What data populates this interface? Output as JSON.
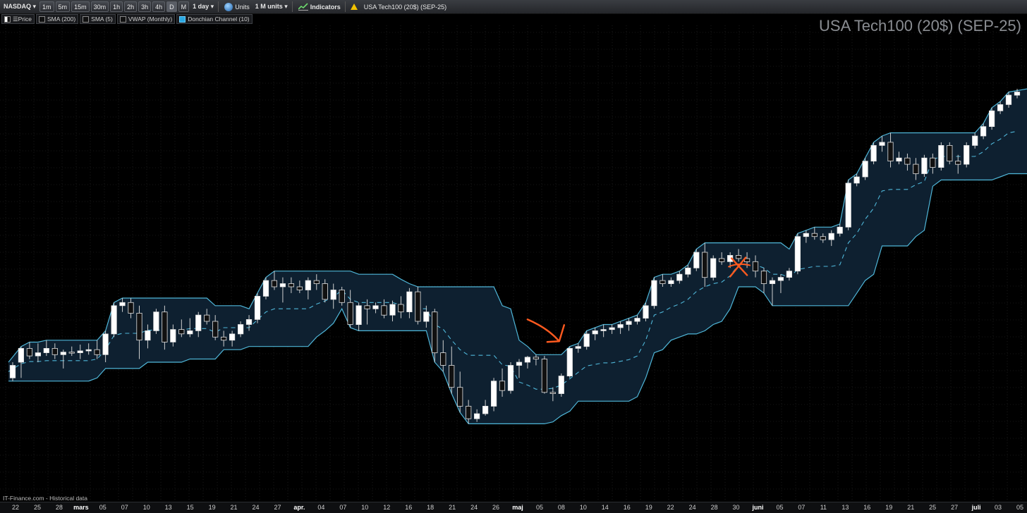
{
  "toolbar": {
    "symbol": "NASDAQ",
    "intervals": [
      "1m",
      "5m",
      "15m",
      "30m",
      "1h",
      "2h",
      "3h",
      "4h",
      "D",
      "M"
    ],
    "active_interval": "D",
    "period": "1 day",
    "units_label": "Units",
    "units_value": "1 M units",
    "indicators_label": "Indicators",
    "instrument": "USA Tech100 (20$) (SEP-25)"
  },
  "legend": {
    "items": [
      {
        "label": "Price",
        "checked": true
      },
      {
        "label": "SMA (200)",
        "checked": false
      },
      {
        "label": "SMA (5)",
        "checked": false
      },
      {
        "label": "VWAP (Monthly)",
        "checked": false
      },
      {
        "label": "Donchian Channel (10)",
        "checked": true
      }
    ]
  },
  "title": "USA Tech100 (20$) (SEP-25)",
  "watermark": "IT-Finance.com - Historical data",
  "colors": {
    "channel_line": "#4fb6d8",
    "channel_fill": "#0f2233",
    "up_candle": "#ffffff",
    "down_candle": "#111111",
    "annotation": "#ff5a1f"
  },
  "x_axis_labels": [
    {
      "label": "22",
      "month": false
    },
    {
      "label": "25",
      "month": false
    },
    {
      "label": "28",
      "month": false
    },
    {
      "label": "mars",
      "month": true
    },
    {
      "label": "05",
      "month": false
    },
    {
      "label": "07",
      "month": false
    },
    {
      "label": "10",
      "month": false
    },
    {
      "label": "13",
      "month": false
    },
    {
      "label": "15",
      "month": false
    },
    {
      "label": "19",
      "month": false
    },
    {
      "label": "21",
      "month": false
    },
    {
      "label": "24",
      "month": false
    },
    {
      "label": "27",
      "month": false
    },
    {
      "label": "apr.",
      "month": true
    },
    {
      "label": "04",
      "month": false
    },
    {
      "label": "07",
      "month": false
    },
    {
      "label": "10",
      "month": false
    },
    {
      "label": "12",
      "month": false
    },
    {
      "label": "16",
      "month": false
    },
    {
      "label": "18",
      "month": false
    },
    {
      "label": "21",
      "month": false
    },
    {
      "label": "24",
      "month": false
    },
    {
      "label": "26",
      "month": false
    },
    {
      "label": "maj",
      "month": true
    },
    {
      "label": "05",
      "month": false
    },
    {
      "label": "08",
      "month": false
    },
    {
      "label": "10",
      "month": false
    },
    {
      "label": "14",
      "month": false
    },
    {
      "label": "16",
      "month": false
    },
    {
      "label": "19",
      "month": false
    },
    {
      "label": "22",
      "month": false
    },
    {
      "label": "24",
      "month": false
    },
    {
      "label": "28",
      "month": false
    },
    {
      "label": "30",
      "month": false
    },
    {
      "label": "juni",
      "month": true
    },
    {
      "label": "05",
      "month": false
    },
    {
      "label": "07",
      "month": false
    },
    {
      "label": "11",
      "month": false
    },
    {
      "label": "13",
      "month": false
    },
    {
      "label": "16",
      "month": false
    },
    {
      "label": "19",
      "month": false
    },
    {
      "label": "21",
      "month": false
    },
    {
      "label": "25",
      "month": false
    },
    {
      "label": "27",
      "month": false
    },
    {
      "label": "juli",
      "month": true
    },
    {
      "label": "03",
      "month": false
    },
    {
      "label": "05",
      "month": false
    }
  ],
  "chart_data": {
    "type": "candlestick",
    "candles": [
      [
        0.35,
        0.6,
        0.3,
        0.55
      ],
      [
        0.6,
        0.85,
        0.35,
        0.82
      ],
      [
        0.82,
        0.92,
        0.65,
        0.7
      ],
      [
        0.7,
        0.9,
        0.6,
        0.75
      ],
      [
        0.75,
        0.95,
        0.7,
        0.82
      ],
      [
        0.82,
        0.9,
        0.65,
        0.72
      ],
      [
        0.72,
        0.8,
        0.5,
        0.76
      ],
      [
        0.76,
        0.85,
        0.7,
        0.75
      ],
      [
        0.75,
        0.88,
        0.65,
        0.78
      ],
      [
        0.78,
        0.9,
        0.72,
        0.8
      ],
      [
        0.8,
        0.95,
        0.65,
        0.72
      ],
      [
        0.72,
        1.1,
        0.6,
        1.05
      ],
      [
        1.05,
        1.55,
        1.0,
        1.5
      ],
      [
        1.5,
        1.62,
        1.4,
        1.55
      ],
      [
        1.55,
        1.62,
        1.3,
        1.38
      ],
      [
        1.38,
        1.5,
        0.65,
        0.95
      ],
      [
        0.95,
        1.2,
        0.82,
        1.1
      ],
      [
        1.1,
        1.45,
        1.05,
        1.4
      ],
      [
        1.4,
        1.5,
        0.8,
        0.92
      ],
      [
        0.92,
        1.2,
        0.85,
        1.12
      ],
      [
        1.12,
        1.28,
        1.0,
        1.05
      ],
      [
        1.05,
        1.3,
        1.0,
        1.1
      ],
      [
        1.1,
        1.4,
        1.0,
        1.35
      ],
      [
        1.35,
        1.45,
        1.2,
        1.25
      ],
      [
        1.25,
        1.35,
        0.95,
        1.0
      ],
      [
        1.0,
        1.1,
        0.85,
        0.95
      ],
      [
        0.95,
        1.1,
        0.85,
        1.05
      ],
      [
        1.05,
        1.25,
        1.0,
        1.2
      ],
      [
        1.2,
        1.35,
        1.1,
        1.28
      ],
      [
        1.28,
        1.7,
        1.22,
        1.65
      ],
      [
        1.65,
        1.95,
        1.6,
        1.9
      ],
      [
        1.9,
        2.05,
        1.75,
        1.8
      ],
      [
        1.8,
        1.95,
        1.55,
        1.85
      ],
      [
        1.85,
        1.95,
        1.7,
        1.8
      ],
      [
        1.8,
        1.9,
        1.7,
        1.75
      ],
      [
        1.75,
        1.95,
        1.6,
        1.9
      ],
      [
        1.9,
        2.0,
        1.75,
        1.85
      ],
      [
        1.85,
        1.92,
        1.55,
        1.6
      ],
      [
        1.6,
        1.85,
        1.45,
        1.75
      ],
      [
        1.75,
        1.8,
        1.5,
        1.55
      ],
      [
        1.55,
        1.75,
        1.15,
        1.2
      ],
      [
        1.2,
        1.55,
        1.1,
        1.5
      ],
      [
        1.5,
        1.6,
        1.2,
        1.45
      ],
      [
        1.45,
        1.55,
        1.38,
        1.5
      ],
      [
        1.5,
        1.6,
        1.3,
        1.35
      ],
      [
        1.35,
        1.58,
        1.25,
        1.52
      ],
      [
        1.52,
        1.65,
        1.3,
        1.4
      ],
      [
        1.4,
        1.78,
        1.3,
        1.72
      ],
      [
        1.72,
        1.8,
        1.2,
        1.25
      ],
      [
        1.25,
        1.5,
        1.15,
        1.4
      ],
      [
        1.4,
        1.45,
        0.6,
        0.75
      ],
      [
        0.75,
        0.95,
        0.45,
        0.55
      ],
      [
        0.55,
        0.85,
        0.1,
        0.2
      ],
      [
        0.2,
        0.45,
        -0.2,
        -0.1
      ],
      [
        -0.1,
        0.0,
        -0.38,
        -0.3
      ],
      [
        -0.3,
        -0.15,
        -0.35,
        -0.22
      ],
      [
        -0.22,
        0.0,
        -0.25,
        -0.1
      ],
      [
        -0.1,
        0.35,
        -0.18,
        0.3
      ],
      [
        0.3,
        0.5,
        0.05,
        0.15
      ],
      [
        0.15,
        0.6,
        0.1,
        0.55
      ],
      [
        0.55,
        0.65,
        0.35,
        0.6
      ],
      [
        0.6,
        0.7,
        0.5,
        0.68
      ],
      [
        0.68,
        0.72,
        0.55,
        0.65
      ],
      [
        0.65,
        0.7,
        0.1,
        0.12
      ],
      [
        0.12,
        0.2,
        -0.02,
        0.1
      ],
      [
        0.1,
        0.42,
        0.05,
        0.38
      ],
      [
        0.38,
        0.85,
        0.35,
        0.82
      ],
      [
        0.82,
        0.9,
        0.75,
        0.85
      ],
      [
        0.85,
        1.1,
        0.8,
        1.05
      ],
      [
        1.05,
        1.15,
        0.95,
        1.1
      ],
      [
        1.1,
        1.2,
        1.0,
        1.12
      ],
      [
        1.12,
        1.2,
        1.05,
        1.15
      ],
      [
        1.15,
        1.25,
        1.05,
        1.2
      ],
      [
        1.2,
        1.3,
        1.1,
        1.25
      ],
      [
        1.25,
        1.35,
        1.2,
        1.3
      ],
      [
        1.3,
        1.55,
        1.25,
        1.5
      ],
      [
        1.5,
        1.95,
        1.45,
        1.9
      ],
      [
        1.9,
        2.0,
        1.8,
        1.85
      ],
      [
        1.85,
        1.95,
        1.8,
        1.9
      ],
      [
        1.9,
        2.05,
        1.85,
        2.0
      ],
      [
        2.0,
        2.15,
        1.95,
        2.1
      ],
      [
        2.1,
        2.4,
        2.05,
        2.35
      ],
      [
        2.35,
        2.5,
        1.8,
        1.95
      ],
      [
        1.95,
        2.3,
        1.9,
        2.25
      ],
      [
        2.25,
        2.35,
        2.15,
        2.2
      ],
      [
        2.2,
        2.35,
        2.1,
        2.3
      ],
      [
        2.3,
        2.4,
        2.2,
        2.25
      ],
      [
        2.25,
        2.35,
        2.1,
        2.2
      ],
      [
        2.2,
        2.3,
        1.95,
        2.05
      ],
      [
        2.05,
        2.1,
        1.7,
        1.85
      ],
      [
        1.85,
        1.95,
        1.5,
        1.9
      ],
      [
        1.9,
        2.0,
        1.7,
        1.95
      ],
      [
        1.95,
        2.1,
        1.9,
        2.05
      ],
      [
        2.05,
        2.65,
        2.0,
        2.6
      ],
      [
        2.6,
        2.7,
        2.5,
        2.65
      ],
      [
        2.65,
        2.75,
        2.55,
        2.6
      ],
      [
        2.6,
        2.65,
        2.5,
        2.55
      ],
      [
        2.55,
        2.7,
        2.45,
        2.65
      ],
      [
        2.65,
        2.8,
        2.6,
        2.75
      ],
      [
        2.75,
        3.5,
        2.7,
        3.45
      ],
      [
        3.45,
        3.6,
        3.4,
        3.55
      ],
      [
        3.55,
        3.85,
        3.5,
        3.8
      ],
      [
        3.8,
        4.1,
        3.75,
        4.05
      ],
      [
        4.05,
        4.2,
        3.95,
        4.1
      ],
      [
        4.1,
        4.25,
        3.7,
        3.8
      ],
      [
        3.8,
        3.95,
        3.75,
        3.85
      ],
      [
        3.85,
        3.92,
        3.65,
        3.75
      ],
      [
        3.75,
        3.85,
        3.5,
        3.6
      ],
      [
        3.6,
        3.9,
        3.55,
        3.85
      ],
      [
        3.85,
        3.92,
        3.6,
        3.7
      ],
      [
        3.7,
        4.1,
        3.65,
        4.05
      ],
      [
        4.05,
        4.1,
        3.75,
        3.8
      ],
      [
        3.8,
        3.9,
        3.6,
        3.75
      ],
      [
        3.75,
        4.1,
        3.7,
        4.05
      ],
      [
        4.05,
        4.25,
        4.0,
        4.2
      ],
      [
        4.2,
        4.4,
        4.15,
        4.35
      ],
      [
        4.35,
        4.65,
        4.3,
        4.6
      ],
      [
        4.6,
        4.75,
        4.55,
        4.7
      ],
      [
        4.7,
        4.9,
        4.65,
        4.85
      ],
      [
        4.85,
        4.95,
        4.8,
        4.9
      ]
    ]
  }
}
